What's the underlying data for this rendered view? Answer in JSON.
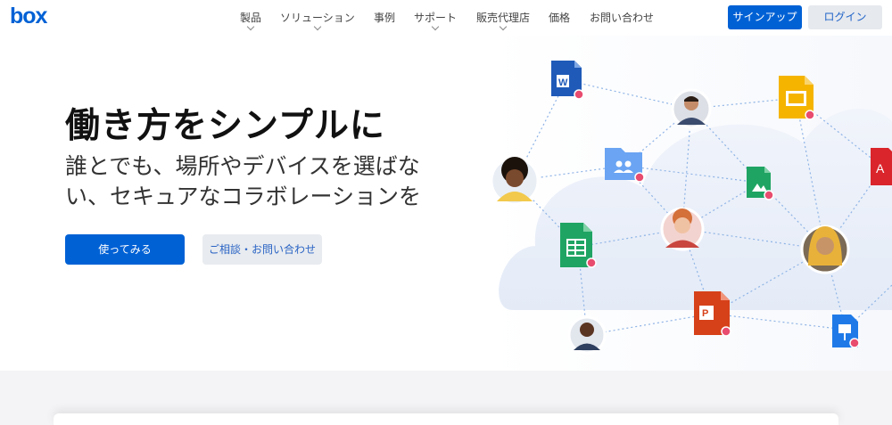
{
  "header": {
    "logo": "box",
    "nav": [
      {
        "label": "製品",
        "has_dropdown": true
      },
      {
        "label": "ソリューション",
        "has_dropdown": true
      },
      {
        "label": "事例",
        "has_dropdown": false
      },
      {
        "label": "サポート",
        "has_dropdown": true
      },
      {
        "label": "販売代理店",
        "has_dropdown": true
      },
      {
        "label": "価格",
        "has_dropdown": false
      },
      {
        "label": "お問い合わせ",
        "has_dropdown": false
      }
    ],
    "signup_label": "サインアップ",
    "login_label": "ログイン"
  },
  "hero": {
    "title": "働き方をシンプルに",
    "subtitle_line1": "誰とでも、場所やデバイスを選ばな",
    "subtitle_line2": "い、セキュアなコラボレーションを",
    "cta_primary": "使ってみる",
    "cta_secondary": "ご相談・お問い合わせ"
  },
  "illustration": {
    "file_icons": [
      "word-doc-icon",
      "slides-icon",
      "shared-folder-icon",
      "image-file-icon",
      "pdf-icon",
      "spreadsheet-icon",
      "powerpoint-icon",
      "keynote-icon"
    ],
    "avatars": 5
  },
  "colors": {
    "brand": "#0061d5",
    "secondary_button_bg": "#e8ebef",
    "cloud": "#e9eef8"
  }
}
